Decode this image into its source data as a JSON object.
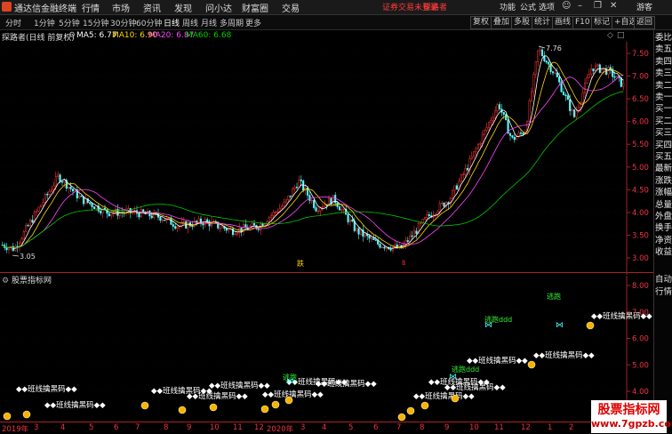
{
  "app": {
    "title": "通达信金融终端",
    "menu": [
      "行情",
      "市场",
      "资讯",
      "发现",
      "问小达",
      "财富圈",
      "交易"
    ],
    "login_status": "证券交易未登录",
    "stock_link": "探路者",
    "right_menu": [
      "功能",
      "公式",
      "选项"
    ],
    "user": "游客"
  },
  "toolbar": {
    "periods": [
      "分时",
      "1分钟",
      "5分钟",
      "15分钟",
      "30分钟",
      "60分钟",
      "日线",
      "周线",
      "月线",
      "多周期",
      "更多"
    ],
    "active_period": "日线",
    "buttons": [
      "复权",
      "叠加",
      "多股",
      "统计",
      "画线",
      "F10",
      "标记",
      "+自选",
      "返回"
    ]
  },
  "info": {
    "stock": "探路者(日线 前复权)",
    "ma5": "MA5: 6.77",
    "ma10": "MA10: 6.90",
    "ma20": "MA20: 6.87",
    "ma60": "MA60: 6.68"
  },
  "price_axis": [
    "7.50",
    "7.00",
    "6.50",
    "6.00",
    "5.50",
    "5.00",
    "4.50",
    "4.00",
    "3.50",
    "3.00"
  ],
  "price_annotations": {
    "high": "7.76",
    "low": "3.05",
    "marker": "跌"
  },
  "colors": {
    "up": "#ff3333",
    "down": "#54ffff",
    "ma5": "#ffffff",
    "ma10": "#ffd700",
    "ma20": "#ff44ff",
    "ma60": "#00c800",
    "axis": "#cc2222"
  },
  "indicator": {
    "name": "股票指标网",
    "axis": [
      "8.00",
      "7.00",
      "6.00",
      "5.00",
      "4.00"
    ],
    "label_main": "◆◆班线擒黑码◆◆",
    "label_a": "逃跑",
    "label_b": "逃跑ddd"
  },
  "date_axis": [
    "2019年",
    "3",
    "4",
    "5",
    "6",
    "7",
    "8",
    "9",
    "10",
    "11",
    "12",
    "2020年",
    "3",
    "4",
    "5",
    "6",
    "7",
    "8",
    "9",
    "10",
    "11",
    "12",
    "1",
    "2"
  ],
  "side_tabs": [
    "委比",
    "卖五",
    "卖四",
    "卖三",
    "卖二",
    "卖一",
    "买一",
    "买二",
    "买三",
    "买四",
    "买五",
    "最新",
    "涨跌",
    "涨幅",
    "总量",
    "外盘",
    "换手",
    "净资",
    "收益",
    "自动",
    "行情"
  ],
  "watermark": {
    "title": "股票指标网",
    "url": "www.7gpzb.com"
  }
}
